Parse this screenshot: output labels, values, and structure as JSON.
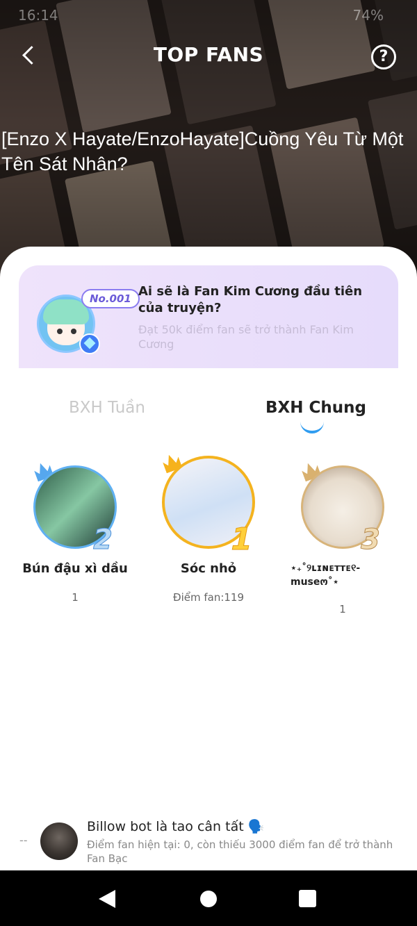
{
  "status": {
    "time": "16:14",
    "battery": "74%"
  },
  "header": {
    "title": "TOP FANS",
    "help": "?"
  },
  "story": {
    "title": "[Enzo X Hayate/EnzoHayate]Cuồng Yêu Từ Một Tên Sát Nhân?"
  },
  "promo": {
    "tag": "No.001",
    "title": "Ai sẽ là Fan Kim Cương đầu tiên của truyện?",
    "subtitle": "Đạt 50k điểm fan sẽ trở thành Fan Kim Cương"
  },
  "tabs": [
    {
      "label": "BXH Tuần",
      "active": false
    },
    {
      "label": "BXH Chung",
      "active": true
    }
  ],
  "leaderboard": [
    {
      "rank": "1",
      "name": "Sóc nhỏ",
      "score": "Điểm fan:119"
    },
    {
      "rank": "2",
      "name": "Bún đậu xì dầu",
      "score": "1"
    },
    {
      "rank": "3",
      "name": "⋆₊˚୨ʟɪɴᴇᴛᴛᴇ୧-museო˚⋆",
      "score": "1"
    }
  ],
  "current_user": {
    "rank": "--",
    "name": "Billow bot là tao cân tất 🗣️",
    "note": "Điểm fan hiện tại: 0, còn thiếu 3000 điểm fan để trở thành Fan Bạc"
  },
  "colors": {
    "accent": "#2f9cf0",
    "gold": "#f4b31f",
    "silver": "#5fb0f2",
    "bronze": "#d8b47a",
    "promo_bg": "#ebe0fb"
  }
}
